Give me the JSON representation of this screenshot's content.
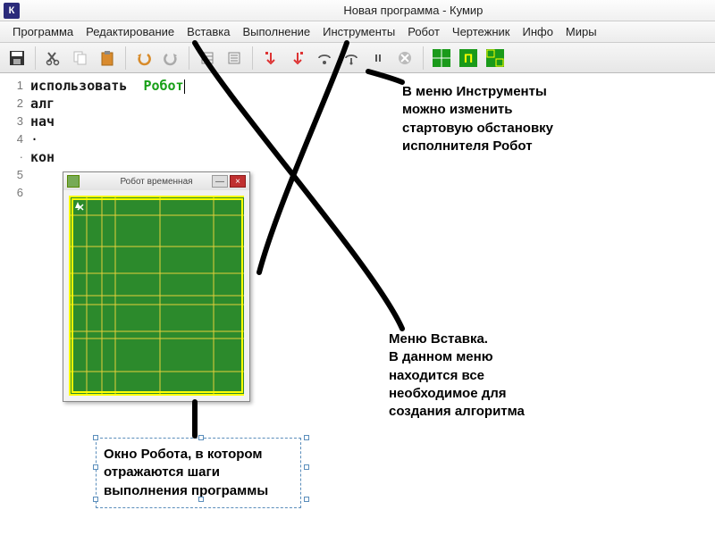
{
  "title": "Новая программа - Кумир",
  "app_icon_letter": "К",
  "menus": [
    "Программа",
    "Редактирование",
    "Вставка",
    "Выполнение",
    "Инструменты",
    "Робот",
    "Чертежник",
    "Инфо",
    "Миры"
  ],
  "code": {
    "l1a": "использовать",
    "l1b": "Робот",
    "l2": "алг",
    "l3": "нач",
    "l4": "·",
    "l5": "кон",
    "l6": ""
  },
  "line_numbers": [
    "1",
    "2",
    "3",
    "4",
    "·",
    "5",
    "6"
  ],
  "robot_window": {
    "title": "Робот временная",
    "minimize": "—",
    "close": "×"
  },
  "annotations": {
    "top_right": "В меню Инструменты можно изменить стартовую обстановку исполнителя Робот",
    "mid_right": "Меню Вставка.\nВ данном меню находится все необходимое для создания алгоритма",
    "bottom": "Окно Робота, в котором отражаются шаги выполнения программы"
  }
}
